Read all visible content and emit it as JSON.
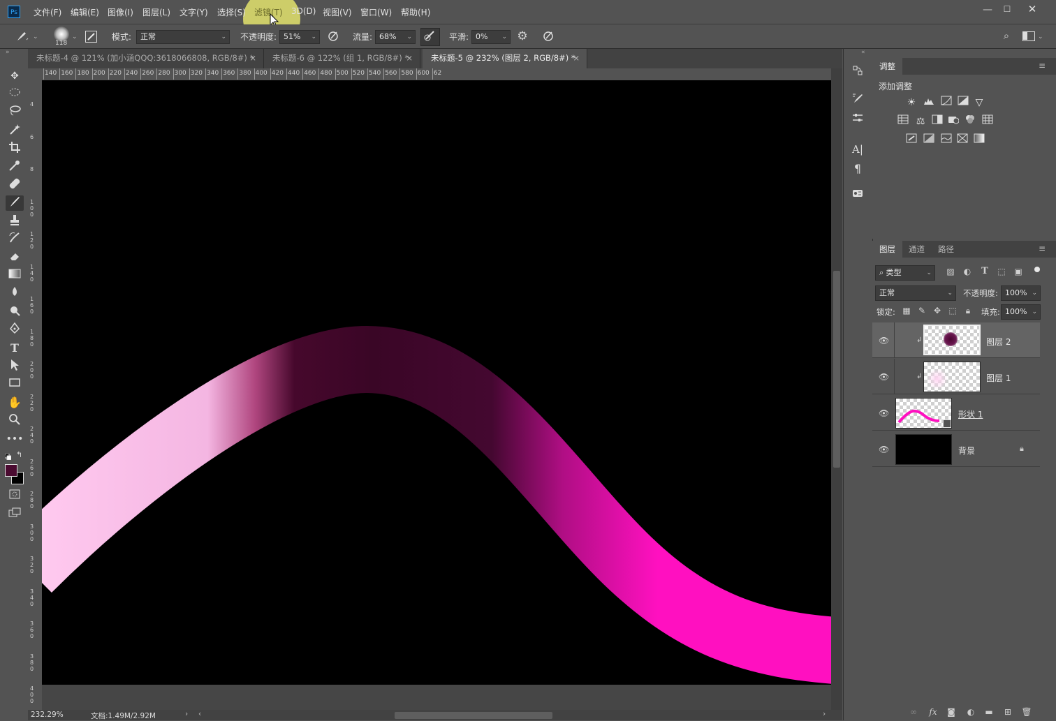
{
  "app": {
    "logo": "Ps"
  },
  "menu": [
    "文件(F)",
    "编辑(E)",
    "图像(I)",
    "图层(L)",
    "文字(Y)",
    "选择(S)",
    "滤镜(T)",
    "3D(D)",
    "视图(V)",
    "窗口(W)",
    "帮助(H)"
  ],
  "window": {
    "minimize": "—",
    "maximize": "☐",
    "close": "✕"
  },
  "options": {
    "brush_size": "118",
    "mode_label": "模式:",
    "mode_value": "正常",
    "opacity_label": "不透明度:",
    "opacity_value": "51%",
    "flow_label": "流量:",
    "flow_value": "68%",
    "smooth_label": "平滑:",
    "smooth_value": "0%"
  },
  "tabs": [
    {
      "label": "未标题-4 @ 121% (加小涵QQQ:3618066808, RGB/8#) *",
      "close": "×"
    },
    {
      "label": "未标题-6 @ 122% (组 1, RGB/8#) *",
      "close": "×"
    },
    {
      "label": "未标题-5 @ 232% (图层 2, RGB/8#) *",
      "close": "×"
    }
  ],
  "ruler_top": [
    "140",
    "160",
    "180",
    "200",
    "220",
    "240",
    "260",
    "280",
    "300",
    "320",
    "340",
    "360",
    "380",
    "400",
    "420",
    "440",
    "460",
    "480",
    "500",
    "520",
    "540",
    "560",
    "580",
    "600",
    "62"
  ],
  "ruler_left": [
    "4",
    "6",
    "8",
    "1 0 0",
    "1 2 0",
    "1 4 0",
    "1 6 0",
    "1 8 0",
    "2 0 0",
    "2 2 0",
    "2 4 0",
    "2 6 0",
    "2 8 0",
    "3 0 0",
    "3 2 0",
    "3 4 0",
    "3 6 0",
    "3 8 0",
    "4 0 0"
  ],
  "status": {
    "zoom": "232.29%",
    "doc": "文档:1.49M/2.92M"
  },
  "colors": {
    "foreground": "#4a0a30",
    "background": "#000000",
    "accent_magenta": "#ff10c0"
  },
  "adjust_panel": {
    "tab": "调整",
    "title": "添加调整"
  },
  "layers_panel": {
    "tabs": [
      "图层",
      "通道",
      "路径"
    ],
    "filter_kind": "类型",
    "blend_mode": "正常",
    "opacity_label": "不透明度:",
    "opacity_value": "100%",
    "lock_label": "锁定:",
    "fill_label": "填充:",
    "fill_value": "100%",
    "layers": [
      {
        "name": "图层 2",
        "selected": true,
        "clipped": true
      },
      {
        "name": "图层 1",
        "selected": false,
        "clipped": true
      },
      {
        "name": "形状 1",
        "selected": false,
        "clipped": false
      },
      {
        "name": "背景",
        "selected": false,
        "clipped": false,
        "locked": true
      }
    ]
  }
}
